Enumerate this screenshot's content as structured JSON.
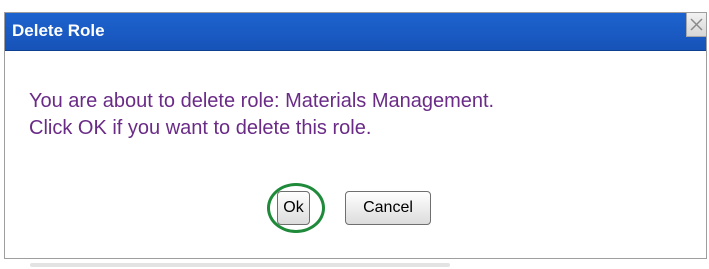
{
  "dialog": {
    "title": "Delete Role",
    "message_line1": "You are about to delete role: Materials Management.",
    "message_line2": "Click OK if you want to delete this role.",
    "ok_label": "Ok",
    "cancel_label": "Cancel",
    "close_icon": "close-icon"
  },
  "colors": {
    "titlebar": "#1d63cf",
    "message_text": "#6a2b87",
    "highlight_ring": "#1e8a3a"
  }
}
